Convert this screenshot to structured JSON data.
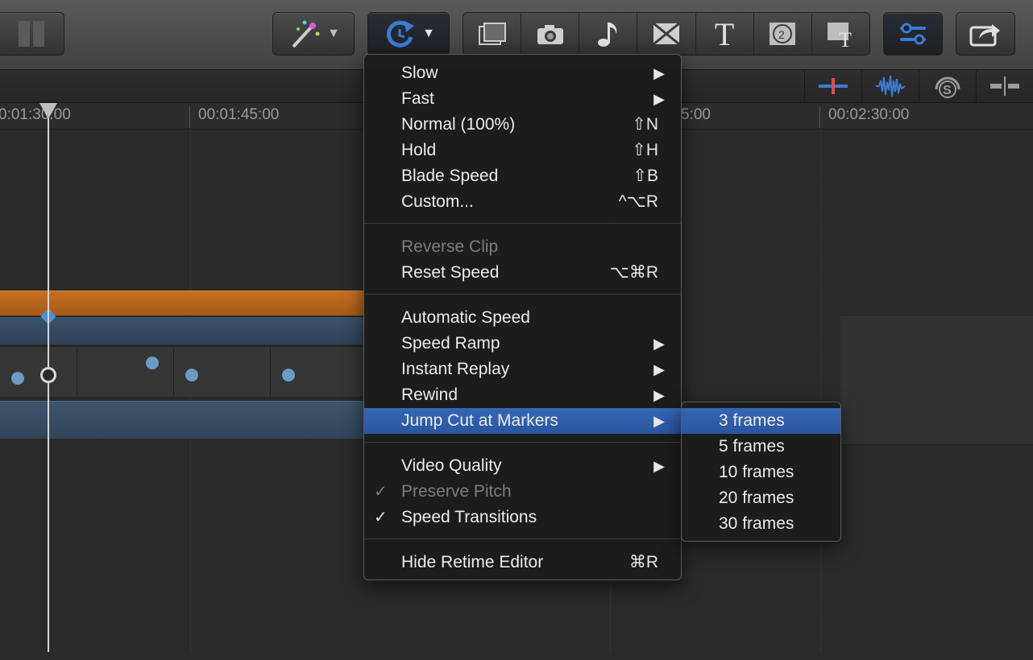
{
  "toolbar": {
    "effects_icon": "magic-wand-icon",
    "retime_icon": "retime-icon",
    "browsers": [
      "film-strip-icon",
      "camera-icon",
      "music-note-icon",
      "transitions-icon",
      "title-icon",
      "generators-icon",
      "themes-icon"
    ],
    "title_glyph": "T",
    "inspector_icon": "inspector-icon",
    "share_icon": "share-icon",
    "accent": "#3a7bd5"
  },
  "timeline": {
    "ruler_labels": [
      "0:01:30:00",
      "00:01:45:00",
      "5:00",
      "00:02:30:00"
    ]
  },
  "menu": {
    "items": [
      {
        "label": "Slow",
        "submenu": true
      },
      {
        "label": "Fast",
        "submenu": true
      },
      {
        "label": "Normal (100%)",
        "shortcut": "⇧N"
      },
      {
        "label": "Hold",
        "shortcut": "⇧H"
      },
      {
        "label": "Blade Speed",
        "shortcut": "⇧B"
      },
      {
        "label": "Custom...",
        "shortcut": "^⌥R"
      },
      {
        "label": "Reverse Clip",
        "disabled": true
      },
      {
        "label": "Reset Speed",
        "shortcut": "⌥⌘R"
      },
      {
        "label": "Automatic Speed"
      },
      {
        "label": "Speed Ramp",
        "submenu": true
      },
      {
        "label": "Instant Replay",
        "submenu": true
      },
      {
        "label": "Rewind",
        "submenu": true
      },
      {
        "label": "Jump Cut at Markers",
        "submenu": true,
        "highlighted": true
      },
      {
        "label": "Video Quality",
        "submenu": true
      },
      {
        "label": "Preserve Pitch",
        "checked": true,
        "disabled": true
      },
      {
        "label": "Speed Transitions",
        "checked": true
      },
      {
        "label": "Hide Retime Editor",
        "shortcut": "⌘R"
      }
    ],
    "check_glyph": "✓",
    "arrow_glyph": "▶"
  },
  "submenu": {
    "items": [
      {
        "label": "3 frames",
        "highlighted": true
      },
      {
        "label": "5 frames"
      },
      {
        "label": "10 frames"
      },
      {
        "label": "20 frames"
      },
      {
        "label": "30 frames"
      }
    ]
  }
}
